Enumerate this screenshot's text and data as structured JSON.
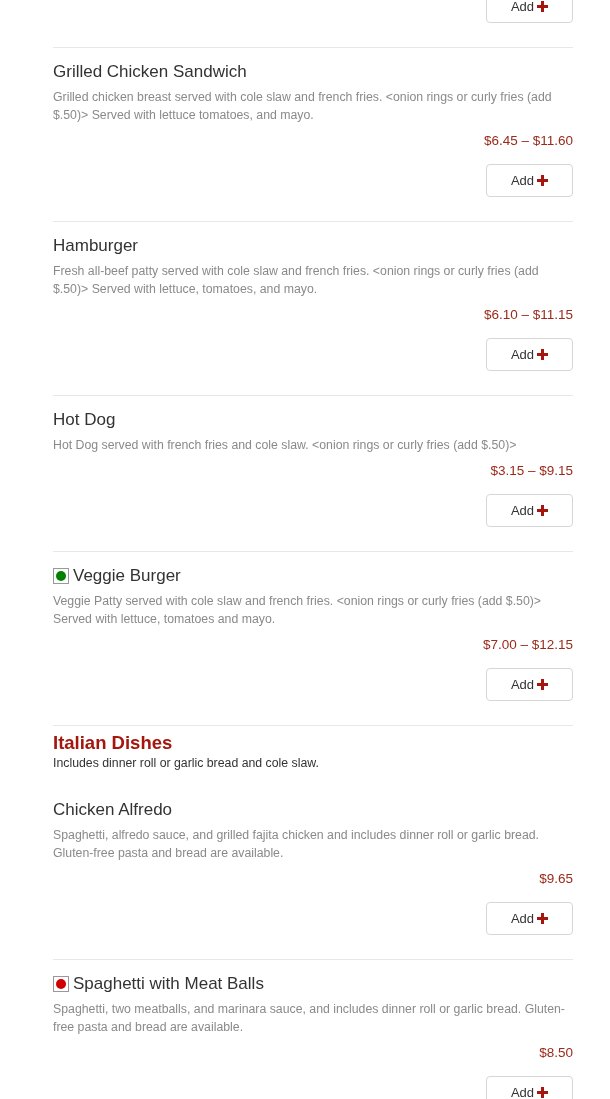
{
  "entries": [
    {
      "kind": "add_only",
      "button": "Add"
    },
    {
      "kind": "item",
      "name": "Grilled Chicken Sandwich",
      "description": "Grilled chicken breast served with cole slaw and french fries.  <onion rings or curly fries (add $.50)> Served with lettuce tomatoes, and mayo.",
      "price": "$6.45 – $11.60",
      "button": "Add"
    },
    {
      "kind": "item",
      "name": "Hamburger",
      "description": "Fresh all-beef patty served with cole slaw and french fries.  <onion rings or curly fries (add $.50)>  Served with lettuce, tomatoes, and mayo.",
      "price": "$6.10 – $11.15",
      "button": "Add"
    },
    {
      "kind": "item",
      "name": "Hot Dog",
      "description": "Hot Dog served with french fries and cole slaw.  <onion rings or curly fries (add $.50)>",
      "price": "$3.15 – $9.15",
      "button": "Add"
    },
    {
      "kind": "item",
      "badge": {
        "color": "#008000"
      },
      "name": "Veggie Burger",
      "description": "Veggie Patty served with cole slaw and french fries.  <onion rings or curly fries (add $.50)> Served with lettuce, tomatoes and mayo.",
      "price": "$7.00 – $12.15",
      "button": "Add"
    },
    {
      "kind": "section",
      "title": "Italian Dishes",
      "subtitle": "Includes dinner roll or garlic bread and cole slaw."
    },
    {
      "kind": "item",
      "name": "Chicken Alfredo",
      "description": "Spaghetti, alfredo sauce, and grilled fajita chicken and includes dinner roll or garlic bread. Gluten-free pasta and bread are available.",
      "price": "$9.65",
      "button": "Add"
    },
    {
      "kind": "item",
      "badge": {
        "color": "#d00000"
      },
      "name": "Spaghetti with Meat Balls",
      "description": "Spaghetti, two meatballs, and marinara sauce, and includes dinner roll or garlic bread. Gluten-free pasta and bread are available.",
      "price": "$8.50",
      "button": "Add"
    }
  ]
}
